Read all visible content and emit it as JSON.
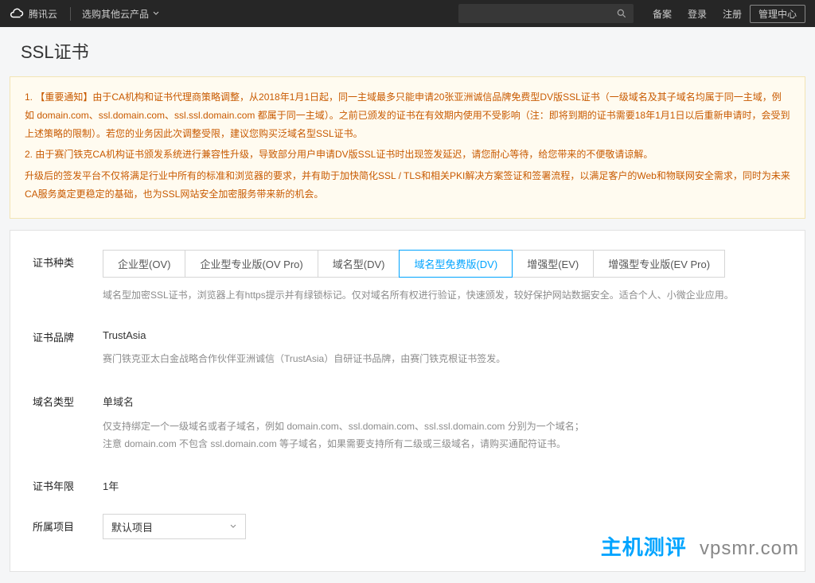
{
  "topbar": {
    "brand": "腾讯云",
    "product_switcher": "选购其他云产品",
    "links": {
      "beian": "备案",
      "login": "登录",
      "register": "注册",
      "console": "管理中心"
    }
  },
  "page": {
    "title": "SSL证书"
  },
  "notice": {
    "p1": "1. 【重要通知】由于CA机构和证书代理商策略调整，从2018年1月1日起，同一主域最多只能申请20张亚洲诚信品牌免费型DV版SSL证书（一级域名及其子域名均属于同一主域，例如 domain.com、ssl.domain.com、ssl.ssl.domain.com 都属于同一主域）。之前已颁发的证书在有效期内使用不受影响（注：即将到期的证书需要18年1月1日以后重新申请时，会受到上述策略的限制）。若您的业务因此次调整受限，建议您购买泛域名型SSL证书。",
    "p2": "2. 由于赛门铁克CA机构证书颁发系统进行兼容性升级，导致部分用户申请DV版SSL证书时出现签发延迟，请您耐心等待，给您带来的不便敬请谅解。",
    "p3": "升级后的签发平台不仅将满足行业中所有的标准和浏览器的要求，并有助于加快简化SSL / TLS和相关PKI解决方案签证和签署流程，以满足客户的Web和物联网安全需求，同时为未来CA服务奠定更稳定的基础，也为SSL网站安全加密服务带来新的机会。"
  },
  "form": {
    "cert_type": {
      "label": "证书种类",
      "tabs": [
        "企业型(OV)",
        "企业型专业版(OV Pro)",
        "域名型(DV)",
        "域名型免费版(DV)",
        "增强型(EV)",
        "增强型专业版(EV Pro)"
      ],
      "active_index": 3,
      "desc": "域名型加密SSL证书，浏览器上有https提示并有绿锁标记。仅对域名所有权进行验证，快速颁发，较好保护网站数据安全。适合个人、小微企业应用。"
    },
    "brand": {
      "label": "证书品牌",
      "value": "TrustAsia",
      "desc": "赛门铁克亚太白金战略合作伙伴亚洲诚信（TrustAsia）自研证书品牌，由赛门铁克根证书签发。"
    },
    "domain_type": {
      "label": "域名类型",
      "value": "单域名",
      "desc_l1": "仅支持绑定一个一级域名或者子域名，例如 domain.com、ssl.domain.com、ssl.ssl.domain.com 分别为一个域名；",
      "desc_l2": "注意 domain.com 不包含 ssl.domain.com 等子域名，如果需要支持所有二级或三级域名，请购买通配符证书。"
    },
    "period": {
      "label": "证书年限",
      "value": "1年"
    },
    "project": {
      "label": "所属项目",
      "selected": "默认项目"
    }
  },
  "watermark": {
    "cn": "主机测评",
    "en": "vpsmr.com"
  }
}
